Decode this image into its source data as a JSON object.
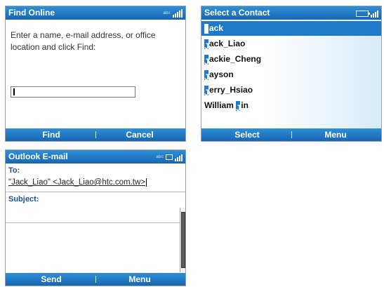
{
  "find_online": {
    "title": "Find Online",
    "status_text": "abc",
    "prompt": "Enter a name, e-mail address, or office location and click Find:",
    "input_value": "",
    "softkeys": {
      "left": "Find",
      "right": "Cancel"
    }
  },
  "select_contact": {
    "title": "Select a Contact",
    "contacts": [
      {
        "prefix": "J",
        "rest": "ack"
      },
      {
        "prefix": "J",
        "rest": "ack_Liao"
      },
      {
        "prefix": "J",
        "rest": "ackie_Cheng"
      },
      {
        "prefix": "J",
        "rest": "ayson"
      },
      {
        "prefix": "J",
        "rest": "erry_Hsiao"
      },
      {
        "before": "William ",
        "prefix": "J",
        "rest": "in"
      }
    ],
    "softkeys": {
      "left": "Select",
      "right": "Menu"
    }
  },
  "outlook_email": {
    "title": "Outlook E-mail",
    "status_text": "abc",
    "to_label": "To:",
    "to_value": "\"Jack_Liao\" <Jack_Liao@htc.com.tw>",
    "subject_label": "Subject:",
    "softkeys": {
      "left": "Send",
      "right": "Menu"
    }
  },
  "colors": {
    "bar_top": "#2f8fd6",
    "bar_bottom": "#1766b3",
    "selection": "#1f7ac7",
    "label_blue": "#1a4f9a"
  }
}
